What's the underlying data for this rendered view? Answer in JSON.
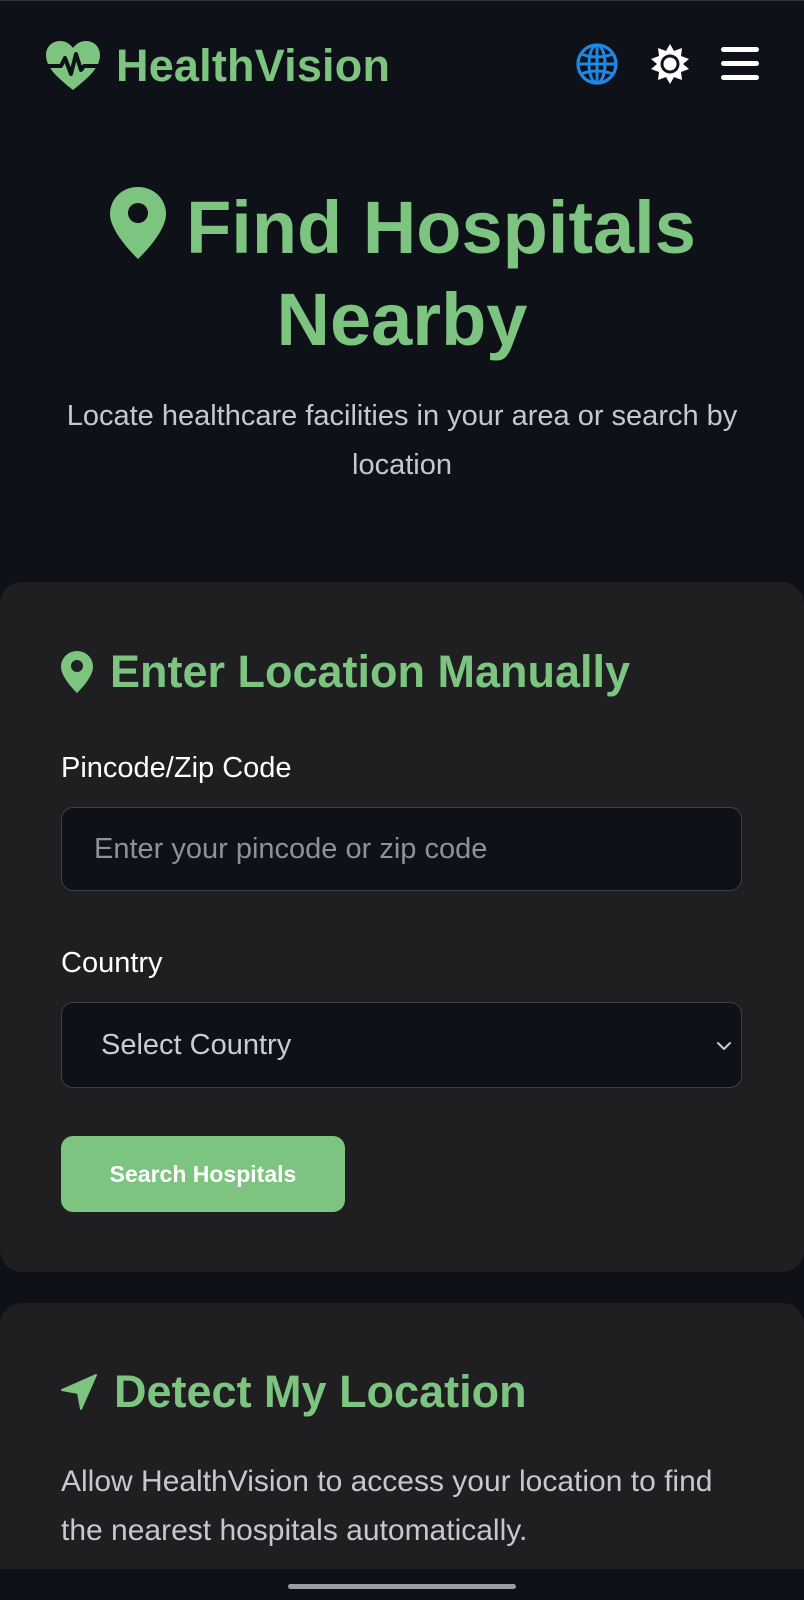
{
  "header": {
    "brand_name": "HealthVision",
    "icons": [
      "heart-pulse-icon",
      "globe-icon",
      "sun-icon",
      "menu-icon"
    ]
  },
  "hero": {
    "title": "Find Hospitals Nearby",
    "subtitle": "Locate healthcare facilities in your area or search by location"
  },
  "manual_card": {
    "heading": "Enter Location Manually",
    "pincode_label": "Pincode/Zip Code",
    "pincode_placeholder": "Enter your pincode or zip code",
    "pincode_value": "",
    "country_label": "Country",
    "country_selected": "Select Country",
    "search_button": "Search Hospitals"
  },
  "detect_card": {
    "heading": "Detect My Location",
    "description": "Allow HealthVision to access your location to find the nearest hospitals automatically."
  },
  "colors": {
    "background": "#0e1118",
    "card": "#1f1f21",
    "accent": "#7cc47f",
    "globe": "#1e88e5",
    "muted_text": "#c5c8cf"
  }
}
